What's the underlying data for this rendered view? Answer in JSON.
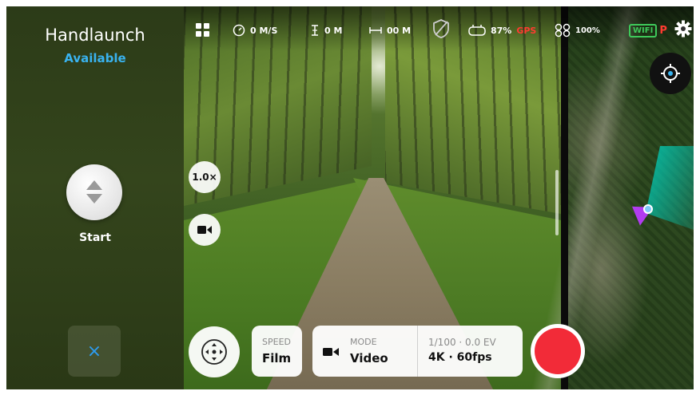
{
  "left_panel": {
    "title": "Handlaunch",
    "status": "Available",
    "start_label": "Start",
    "close_glyph": "×"
  },
  "topbar": {
    "speed": "0 M/S",
    "altitude": "0 M",
    "distance": "00 M",
    "battery": "87%",
    "gps_label": "GPS",
    "signal": "100%",
    "wifi_label": "WIFI",
    "flight_mode": "P"
  },
  "camera": {
    "zoom": "1.0×"
  },
  "bottom": {
    "speed_label": "SPEED",
    "speed_value": "Film",
    "mode_label": "MODE",
    "mode_value": "Video",
    "exposure": "1/100 · 0.0 EV",
    "resolution": "4K · 60fps"
  },
  "icons": [
    "grid-icon",
    "speedometer-icon",
    "altitude-icon",
    "distance-icon",
    "shield-icon",
    "controller-icon",
    "drone-signal-icon",
    "wifi-icon",
    "gear-icon",
    "locate-icon",
    "video-camera-icon",
    "joystick-icon",
    "close-icon",
    "start-arrows-icon"
  ],
  "colors": {
    "accent_blue": "#39b3f0",
    "record_red": "#f22b38",
    "gps_red": "#ff3b30",
    "wifi_green": "#3ec95a",
    "fov_cyan": "#00d2be",
    "drone_purple": "#b23cf0"
  }
}
